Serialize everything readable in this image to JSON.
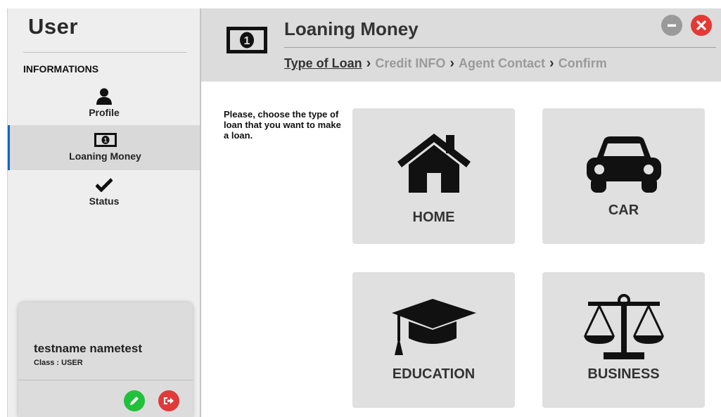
{
  "sidebar": {
    "title": "User",
    "section": "INFORMATIONS",
    "items": [
      {
        "label": "Profile",
        "icon": "user-icon"
      },
      {
        "label": "Loaning Money",
        "icon": "money-bill-icon"
      },
      {
        "label": "Status",
        "icon": "checkmark-icon"
      }
    ],
    "active_index": 1
  },
  "user": {
    "name": "testname nametest",
    "class_label": "Class : USER"
  },
  "header": {
    "title": "Loaning Money",
    "steps": [
      "Type of Loan",
      "Credit INFO",
      "Agent Contact",
      "Confirm"
    ],
    "current_step": 0
  },
  "main": {
    "instruction": "Please, choose the type of loan that you want to make a loan.",
    "tiles": [
      {
        "label": "HOME",
        "icon": "house-icon"
      },
      {
        "label": "CAR",
        "icon": "car-icon"
      },
      {
        "label": "EDUCATION",
        "icon": "graduation-cap-icon"
      },
      {
        "label": "BUSINESS",
        "icon": "balance-scale-icon"
      }
    ]
  },
  "colors": {
    "accent": "#1565c0",
    "edit_green": "#22c13b",
    "logout_red": "#e03a3a",
    "close_red": "#e53935",
    "tile_bg": "#e0e0e0",
    "header_bg": "#dcdcdc"
  }
}
